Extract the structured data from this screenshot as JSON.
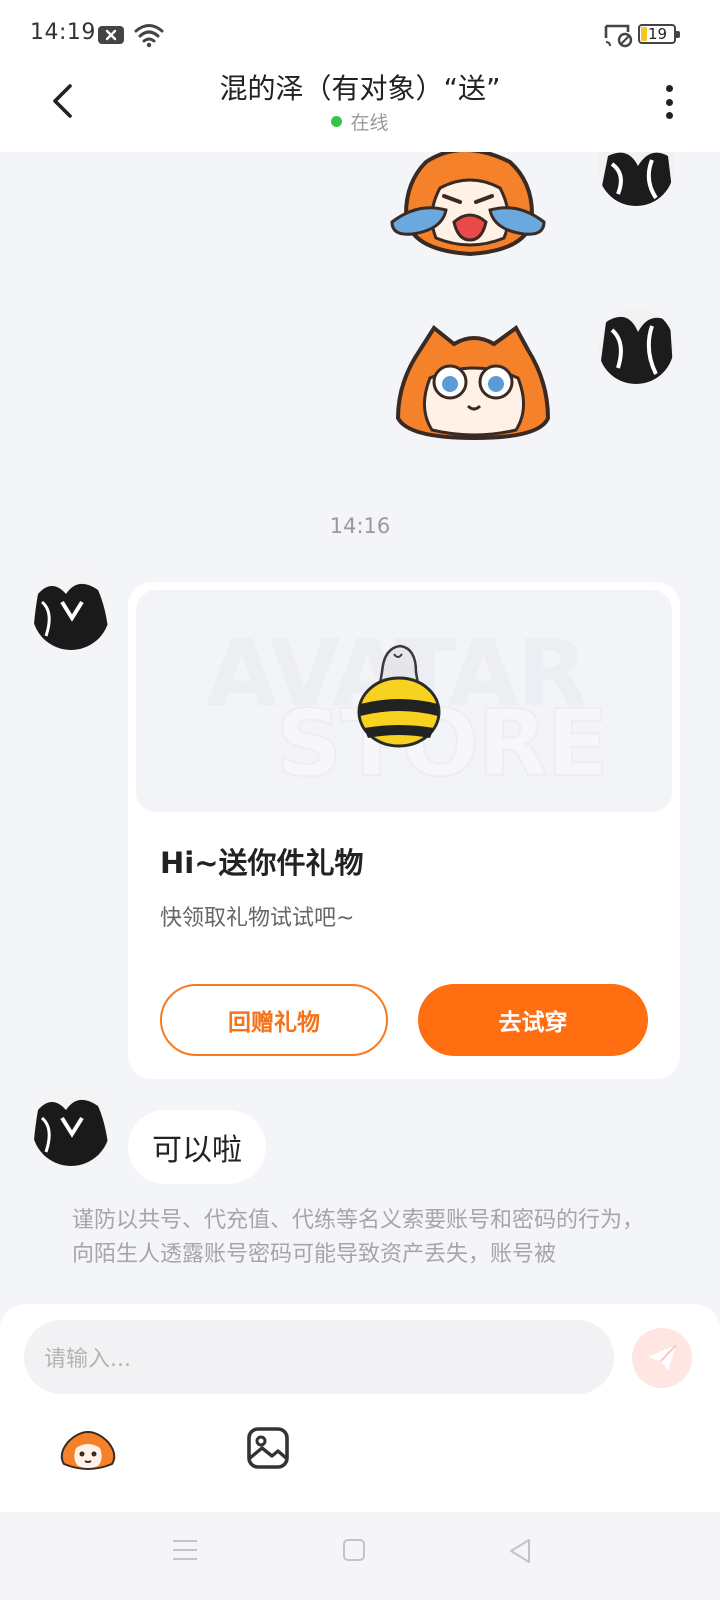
{
  "status_bar": {
    "time": "14:19",
    "battery": "19"
  },
  "header": {
    "title": "混的泽（有对象）“送”",
    "online_status": "在线"
  },
  "chat": {
    "timestamp": "14:16",
    "gift_card": {
      "watermark_line1": "AVATAR",
      "watermark_line2": "STORE",
      "title": "Hi~送你件礼物",
      "subtitle": "快领取礼物试试吧~",
      "return_gift_label": "回赠礼物",
      "try_on_label": "去试穿"
    },
    "text_message": "可以啦",
    "notice": "谨防以共号、代充值、代练等名义索要账号和密码的行为，向陌生人透露账号密码可能导致资产丢失，账号被"
  },
  "input": {
    "placeholder": "请输入..."
  },
  "colors": {
    "accent": "#ff6f12",
    "online": "#36c34a"
  }
}
